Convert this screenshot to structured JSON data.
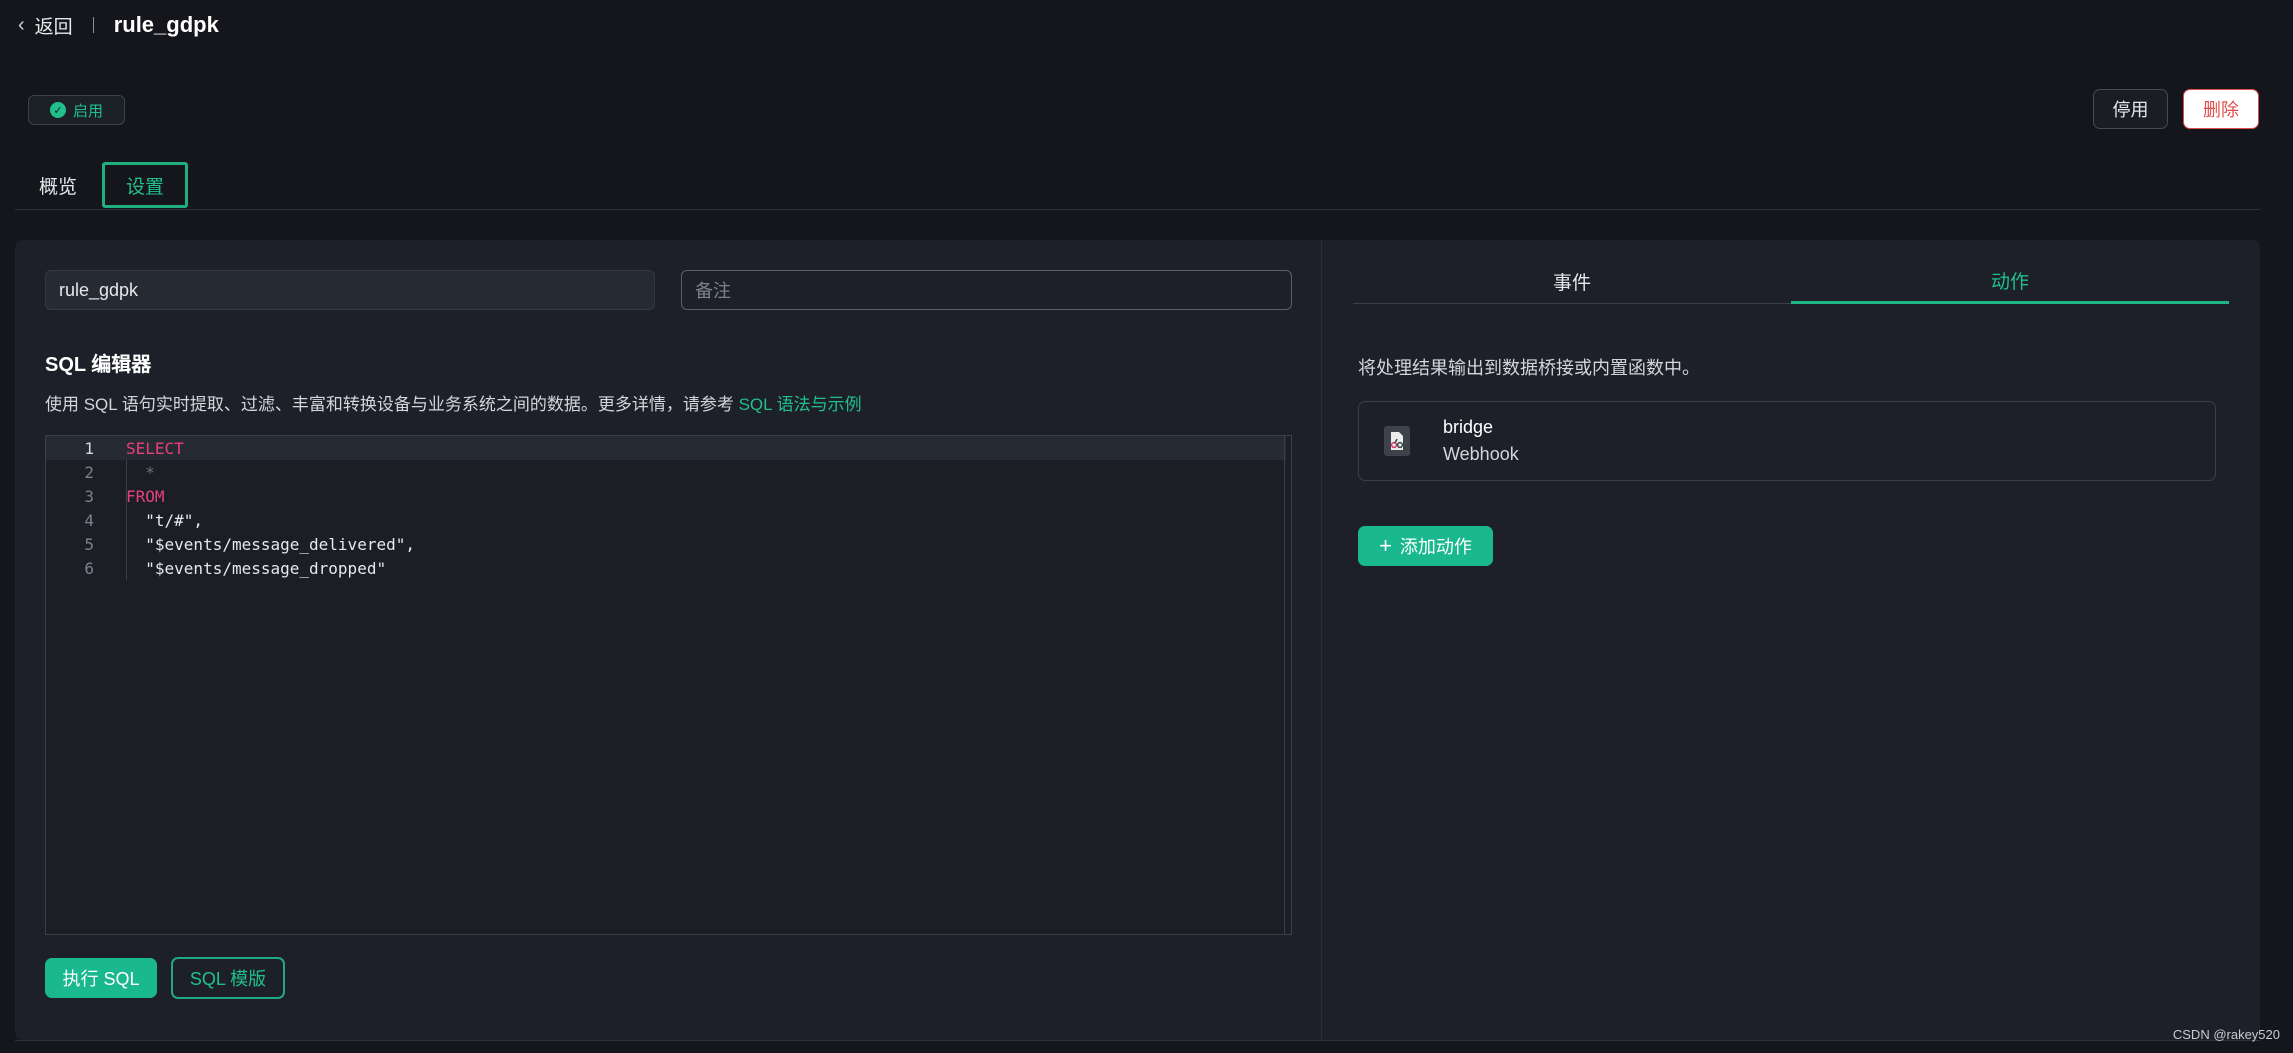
{
  "header": {
    "back_label": "返回",
    "title": "rule_gdpk"
  },
  "status": {
    "label": "启用",
    "color": "#21c08b"
  },
  "toolbar": {
    "disable_label": "停用",
    "delete_label": "删除"
  },
  "tabs": [
    {
      "label": "概览"
    },
    {
      "label": "设置"
    }
  ],
  "settings": {
    "name_value": "rule_gdpk",
    "note_placeholder": "备注",
    "sql_title": "SQL 编辑器",
    "sql_desc": "使用 SQL 语句实时提取、过滤、丰富和转换设备与业务系统之间的数据。更多详情，请参考 ",
    "sql_link": "SQL 语法与示例",
    "code_lines": [
      {
        "num": "1",
        "text": "SELECT"
      },
      {
        "num": "2",
        "text": "  *"
      },
      {
        "num": "3",
        "text": "FROM"
      },
      {
        "num": "4",
        "text": "  \"t/#\","
      },
      {
        "num": "5",
        "text": "  \"$events/message_delivered\","
      },
      {
        "num": "6",
        "text": "  \"$events/message_dropped\""
      }
    ],
    "run_label": "执行 SQL",
    "template_label": "SQL 模版"
  },
  "right": {
    "tab_events": "事件",
    "tab_actions": "动作",
    "actions_desc": "将处理结果输出到数据桥接或内置函数中。",
    "action": {
      "name": "bridge",
      "type": "Webhook"
    },
    "add_label": "添加动作"
  },
  "watermark": "CSDN @rakey520",
  "colors": {
    "accent": "#21c08b",
    "danger": "#e04d4d",
    "keyword": "#e8407a"
  }
}
